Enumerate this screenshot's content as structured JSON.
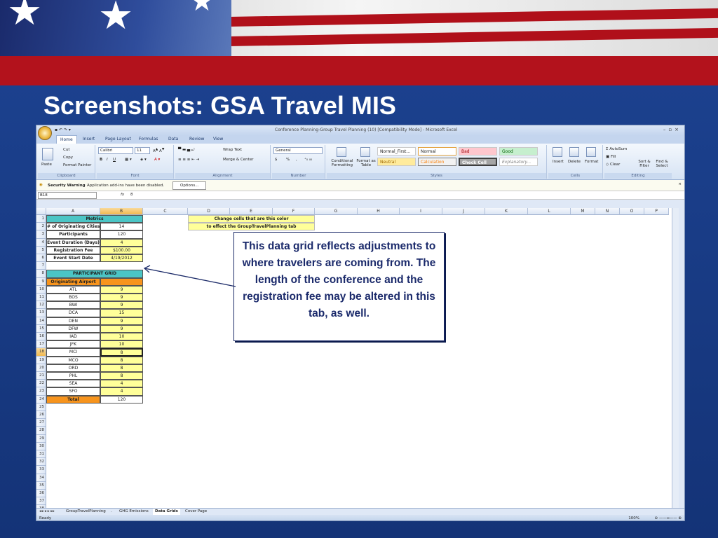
{
  "slide": {
    "title": "Screenshots: GSA Travel MIS"
  },
  "callout": "This data grid reflects adjustments to where travelers are coming from. The length of the conference and the registration fee may be altered in this tab, as well.",
  "excel": {
    "window_title": "Conference Planning-Group Travel Planning (10)  [Compatibility Mode] - Microsoft Excel",
    "tabs": [
      "Home",
      "Insert",
      "Page Layout",
      "Formulas",
      "Data",
      "Review",
      "View"
    ],
    "clipboard": {
      "paste": "Paste",
      "cut": "Cut",
      "copy": "Copy",
      "format_painter": "Format Painter",
      "group": "Clipboard"
    },
    "font": {
      "name": "Calibri",
      "size": "11",
      "group": "Font"
    },
    "alignment": {
      "wrap": "Wrap Text",
      "merge": "Merge & Center",
      "group": "Alignment"
    },
    "number": {
      "format": "General",
      "group": "Number",
      "currency": "$",
      "percent": "%",
      "comma": ","
    },
    "styles": {
      "cond": "Conditional Formatting",
      "table": "Format as Table",
      "group": "Styles",
      "cells": [
        "Normal_First...",
        "Normal",
        "Bad",
        "Good",
        "Neutral",
        "Calculation",
        "Check Cell",
        "Explanatory..."
      ]
    },
    "cells_group": {
      "insert": "Insert",
      "delete": "Delete",
      "format": "Format",
      "group": "Cells"
    },
    "editing": {
      "autosum": "AutoSum",
      "fill": "Fill",
      "clear": "Clear",
      "sort": "Sort & Filter",
      "find": "Find & Select",
      "group": "Editing"
    },
    "security": {
      "label": "Security Warning",
      "message": "Application add-ins have been disabled.",
      "button": "Options..."
    },
    "namebox": "B18",
    "fx": "fx",
    "formula": "8",
    "columns": [
      "A",
      "B",
      "C",
      "D",
      "E",
      "F",
      "G",
      "H",
      "I",
      "J",
      "K",
      "L",
      "M",
      "N",
      "O",
      "P"
    ],
    "note": [
      "Change cells that are this color",
      "to effect the GroupTravelPlanning tab"
    ],
    "metrics_header": "Metrics",
    "metrics": [
      [
        "# of Originating Cities",
        "14"
      ],
      [
        "Participants",
        "120"
      ],
      [
        "Event Duration (Days)",
        "4"
      ],
      [
        "Registration Fee",
        "$100.00"
      ],
      [
        "Event Start Date",
        "4/19/2012"
      ]
    ],
    "grid_header": "PARTICIPANT GRID",
    "grid_col": "Originating Airport",
    "airports": [
      [
        "ATL",
        "9"
      ],
      [
        "BOS",
        "9"
      ],
      [
        "BWI",
        "9"
      ],
      [
        "DCA",
        "15"
      ],
      [
        "DEN",
        "9"
      ],
      [
        "DFW",
        "9"
      ],
      [
        "IAD",
        "10"
      ],
      [
        "JFK",
        "10"
      ],
      [
        "MCI",
        "8"
      ],
      [
        "MCO",
        "8"
      ],
      [
        "ORD",
        "8"
      ],
      [
        "PHL",
        "8"
      ],
      [
        "SEA",
        "4"
      ],
      [
        "SFO",
        "4"
      ]
    ],
    "total": [
      "Total",
      "120"
    ],
    "sheets": [
      "GroupTravelPlanning",
      ".",
      "GHG Emissions",
      "Data Grids",
      "Cover Page"
    ],
    "status": "Ready",
    "zoom": "100%"
  }
}
